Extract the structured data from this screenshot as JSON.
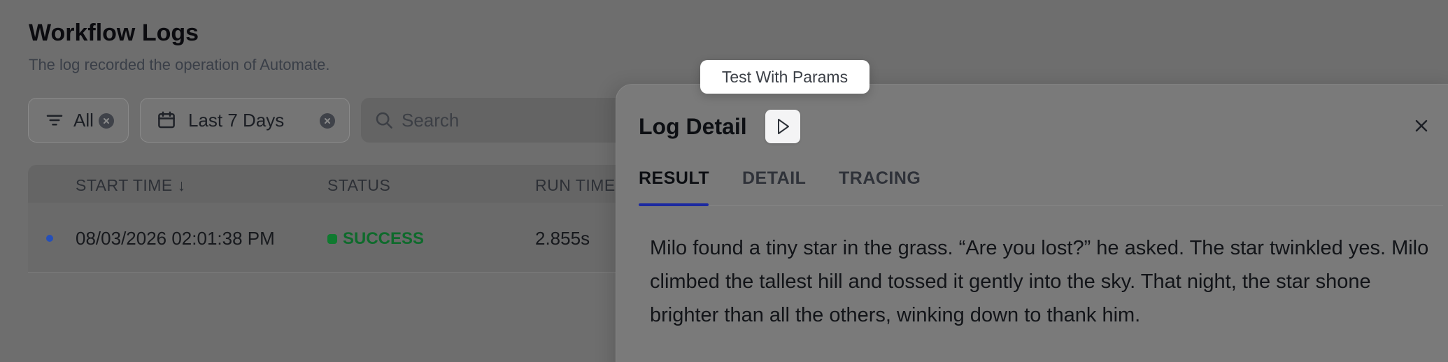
{
  "page": {
    "title": "Workflow Logs",
    "subtitle": "The log recorded the operation of Automate."
  },
  "filters": {
    "status_value": "All",
    "date_value": "Last 7 Days",
    "search_placeholder": "Search"
  },
  "table": {
    "columns": [
      "START TIME ↓",
      "STATUS",
      "RUN TIME"
    ],
    "rows": [
      {
        "start_time": "08/03/2026 02:01:38 PM",
        "status": "SUCCESS",
        "run_time": "2.855s"
      }
    ]
  },
  "drawer": {
    "title": "Log Detail",
    "tooltip": "Test With Params",
    "tabs": [
      {
        "label": "RESULT",
        "active": true
      },
      {
        "label": "DETAIL",
        "active": false
      },
      {
        "label": "TRACING",
        "active": false
      }
    ],
    "result_text": "Milo found a tiny star in the grass. “Are you lost?” he asked. The star twinkled yes. Milo climbed the tallest hill and tossed it gently into the sky. That night, the star shone brighter than all the others, winking down to thank him."
  },
  "colors": {
    "accent_tab": "#1c2aa0",
    "success": "#0f7a2f",
    "unread_dot": "#254fb8"
  },
  "icons": [
    "filter-icon",
    "clear-icon",
    "calendar-icon",
    "search-icon",
    "play-icon",
    "close-icon",
    "arrow-down-icon"
  ]
}
